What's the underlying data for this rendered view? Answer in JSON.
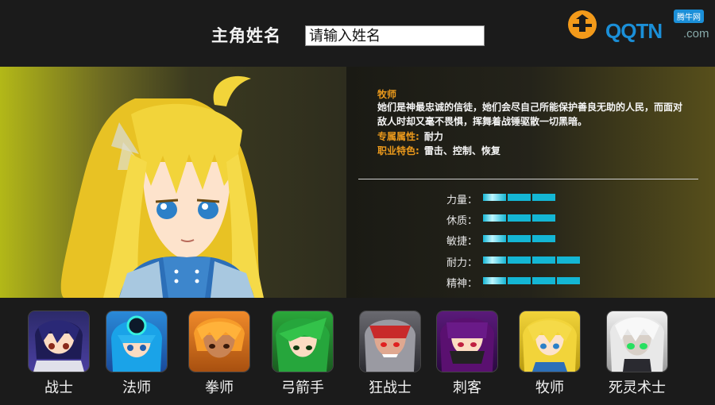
{
  "header": {
    "name_label": "主角姓名",
    "name_placeholder": "请输入姓名"
  },
  "logo": {
    "text": "QQTN",
    "suffix": ".com",
    "badge": "腾牛网"
  },
  "selected_class": {
    "title": "牧师",
    "description": "她们是神最忠诚的信徒，她们会尽自己所能保护善良无助的人民，而面对敌人时却又毫不畏惧，挥舞着战锤驱散一切黑暗。",
    "attr_key": "专属属性:",
    "attr_value": "耐力",
    "feature_key": "职业特色:",
    "feature_value": "雷击、控制、恢复"
  },
  "stats": [
    {
      "label": "力量：",
      "segments": 3
    },
    {
      "label": "休质：",
      "segments": 3
    },
    {
      "label": "敏捷：",
      "segments": 3
    },
    {
      "label": "耐力：",
      "segments": 4
    },
    {
      "label": "精神：",
      "segments": 4
    }
  ],
  "characters": [
    {
      "name": "战士"
    },
    {
      "name": "法师"
    },
    {
      "name": "拳师"
    },
    {
      "name": "弓箭手"
    },
    {
      "name": "狂战士"
    },
    {
      "name": "刺客"
    },
    {
      "name": "牧师"
    },
    {
      "name": "死灵术士"
    }
  ],
  "colors": {
    "accent_orange": "#ec9a1c",
    "stat_bar": "#14b6d4",
    "brand_blue": "#1b8fd8"
  }
}
